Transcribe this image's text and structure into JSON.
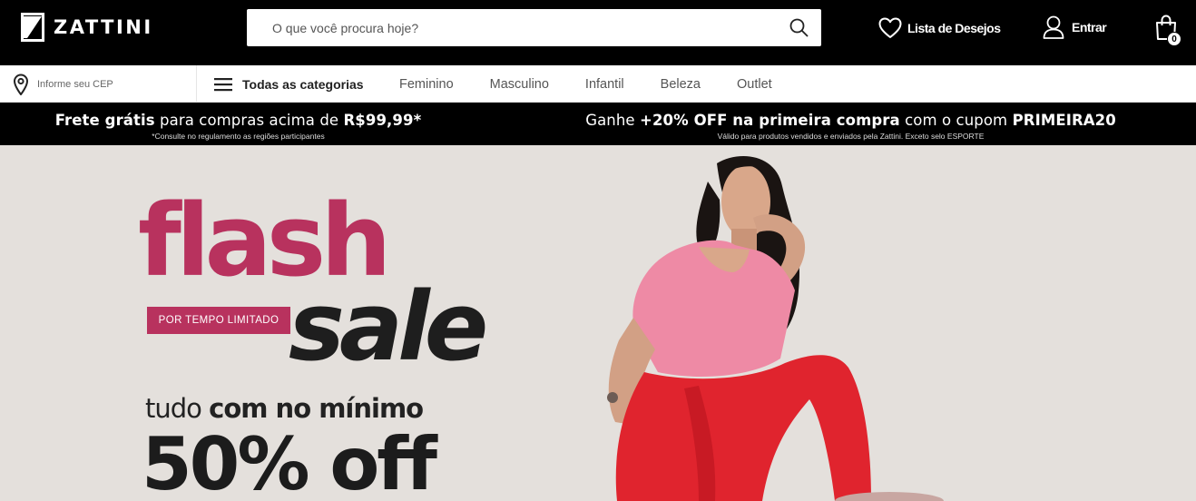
{
  "header": {
    "brand": "ZATTINI",
    "search_placeholder": "O que você procura hoje?",
    "wishlist_label": "Lista de Desejos",
    "login_label": "Entrar",
    "cart_count": "0"
  },
  "nav": {
    "cep_placeholder": "Informe seu CEP",
    "all_categories": "Todas as categorias",
    "links": [
      "Feminino",
      "Masculino",
      "Infantil",
      "Beleza",
      "Outlet"
    ]
  },
  "promo": {
    "left_main_bold_1": "Frete grátis",
    "left_main_text": " para compras acima de ",
    "left_main_bold_2": "R$99,99*",
    "left_sub": "*Consulte no regulamento as regiões participantes",
    "right_main_text_1": "Ganhe ",
    "right_main_bold_1": "+20% OFF na primeira compra",
    "right_main_text_2": " com o cupom ",
    "right_main_bold_2": "PRIMEIRA20",
    "right_sub": "Válido para produtos vendidos e enviados pela Zattini. Exceto selo ESPORTE"
  },
  "banner": {
    "flash": "flash",
    "tag": "POR TEMPO LIMITADO",
    "sale": "sale",
    "tudo_text": "tudo ",
    "tudo_bold": "com no mínimo",
    "off": "50% off"
  },
  "colors": {
    "accent": "#b8325e",
    "header_bg": "#000000",
    "banner_bg": "#e4e0dc"
  }
}
